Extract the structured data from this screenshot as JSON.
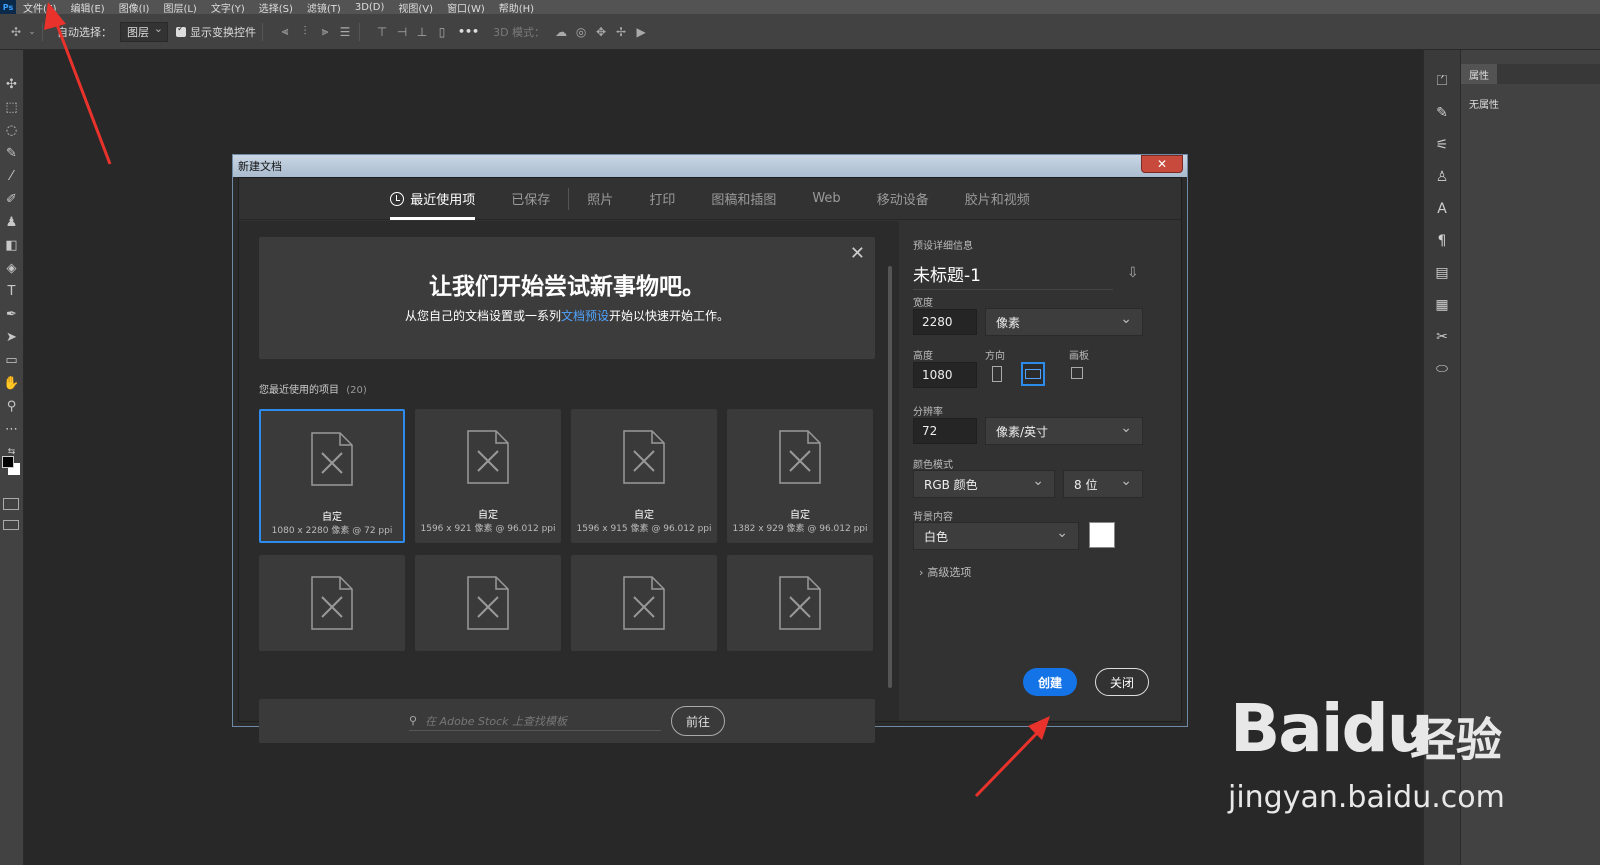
{
  "menubar": {
    "logo": "Ps",
    "items": [
      "文件(F)",
      "编辑(E)",
      "图像(I)",
      "图层(L)",
      "文字(Y)",
      "选择(S)",
      "滤镜(T)",
      "3D(D)",
      "视图(V)",
      "窗口(W)",
      "帮助(H)"
    ]
  },
  "options": {
    "auto_select_label": "自动选择：",
    "auto_select_value": "图层",
    "show_transform_label": "显示变换控件",
    "mode3d_label": "3D 模式：",
    "more": "•••"
  },
  "properties_panel": {
    "tab": "属性",
    "empty": "无属性"
  },
  "dialog": {
    "title": "新建文档",
    "close": "✕",
    "tabs": [
      "最近使用项",
      "已保存",
      "照片",
      "打印",
      "图稿和插图",
      "Web",
      "移动设备",
      "胶片和视频"
    ],
    "hero": {
      "heading": "让我们开始尝试新事物吧。",
      "sub_before": "从您自己的文档设置或一系列",
      "sub_link": "文档预设",
      "sub_after": "开始以快速开始工作。"
    },
    "recent_label": "您最近使用的项目",
    "recent_count": "(20)",
    "cards": [
      {
        "name": "自定",
        "meta": "1080 x 2280 像素 @ 72 ppi",
        "selected": true
      },
      {
        "name": "自定",
        "meta": "1596 x 921 像素 @ 96.012 ppi",
        "selected": false
      },
      {
        "name": "自定",
        "meta": "1596 x 915 像素 @ 96.012 ppi",
        "selected": false
      },
      {
        "name": "自定",
        "meta": "1382 x 929 像素 @ 96.012 ppi",
        "selected": false
      }
    ],
    "stock_placeholder": "在 Adobe Stock 上查找模板",
    "stock_go": "前往",
    "detail": {
      "section": "预设详细信息",
      "doc_name": "未标题-1",
      "width_label": "宽度",
      "width_value": "2280",
      "width_unit": "像素",
      "height_label": "高度",
      "height_value": "1080",
      "orientation_label": "方向",
      "artboard_label": "画板",
      "resolution_label": "分辨率",
      "resolution_value": "72",
      "resolution_unit": "像素/英寸",
      "color_mode_label": "颜色模式",
      "color_mode_value": "RGB 颜色",
      "bit_depth": "8 位",
      "bg_label": "背景内容",
      "bg_value": "白色",
      "bg_color": "#ffffff",
      "advanced": "高级选项",
      "create": "创建",
      "close": "关闭"
    }
  },
  "watermark": {
    "brand": "Baidu",
    "brand_cn": "经验",
    "url": "jingyan.baidu.com"
  },
  "colors": {
    "accent": "#1473e6",
    "selected_border": "#2d8ceb",
    "link": "#4fa3ff",
    "annotation_arrow": "#e8322b"
  }
}
